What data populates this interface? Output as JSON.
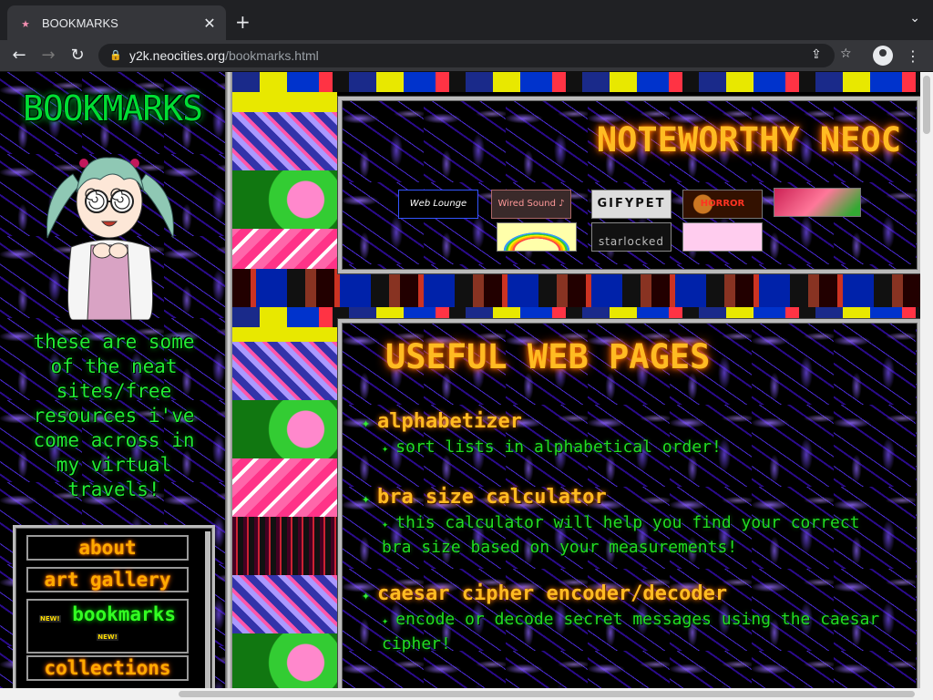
{
  "browser": {
    "tab_title": "BOOKMARKS",
    "url_host": "y2k.neocities.org",
    "url_path": "/bookmarks.html"
  },
  "sidebar": {
    "title": "BOOKMARKS",
    "intro": "these are some of the neat sites/free resources i've come across in my virtual travels!",
    "nav": [
      {
        "label": "about"
      },
      {
        "label": "art gallery"
      },
      {
        "label": "bookmarks",
        "new_badge": "NEW!"
      },
      {
        "label": "collections"
      }
    ]
  },
  "neoc": {
    "title": "NOTEWORTHY NEOC",
    "buttons": [
      {
        "label": "Web Lounge"
      },
      {
        "label": "Wired Sound ♪"
      },
      {
        "label": "GIFYPET"
      },
      {
        "label": "HORROR"
      },
      {
        "label": ""
      },
      {
        "label": ""
      },
      {
        "label": "starlocked"
      },
      {
        "label": ""
      }
    ]
  },
  "useful": {
    "title": "USEFUL WEB PAGES",
    "entries": [
      {
        "name": "alphabetizer",
        "desc": "sort lists in alphabetical order!"
      },
      {
        "name": "bra size calculator",
        "desc": "this calculator will help you find your correct bra size based on your measurements!"
      },
      {
        "name": "caesar cipher encoder/decoder",
        "desc": "encode or decode secret messages using the caesar cipher!"
      }
    ]
  },
  "colors": {
    "neon_green": "#22ee33",
    "neon_orange": "#ffbb22",
    "plasma": "#1a0050"
  }
}
